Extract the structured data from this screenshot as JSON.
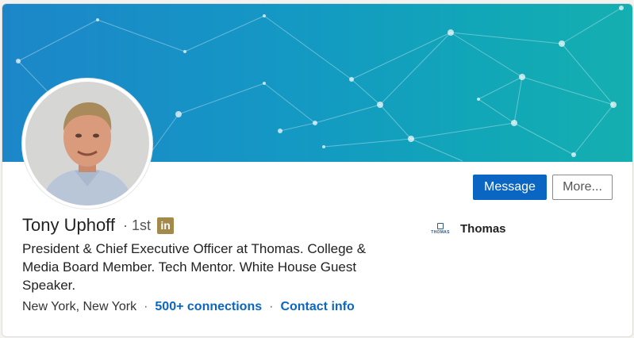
{
  "profile": {
    "name": "Tony Uphoff",
    "degree": "1st",
    "linkedin_badge": "in",
    "headline": "President & Chief Executive Officer at Thomas. College & Media Board Member. Tech Mentor. White House Guest Speaker.",
    "location": "New York, New York",
    "connections": "500+ connections",
    "contact_info": "Contact info",
    "separator": "·"
  },
  "actions": {
    "message_label": "Message",
    "more_label": "More..."
  },
  "company": {
    "name": "Thomas",
    "logo_text": "THOMAS"
  },
  "colors": {
    "banner_start": "#1c86c9",
    "banner_end": "#14afb0",
    "link": "#0a66c2",
    "primary_button": "#0a66c2",
    "premium_badge": "#a38a4b"
  }
}
